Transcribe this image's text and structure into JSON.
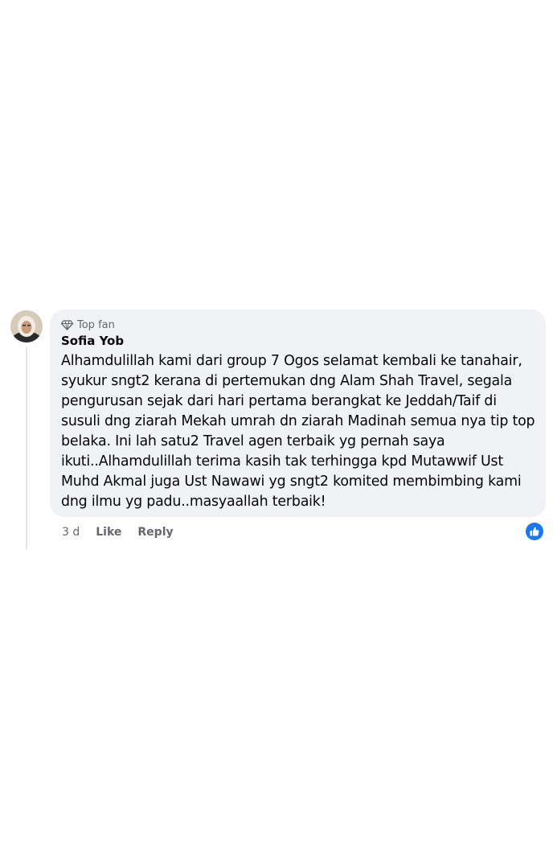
{
  "comment": {
    "badge_label": "Top fan",
    "author": "Sofia Yob",
    "text": "Alhamdulillah kami dari group 7 Ogos selamat kembali ke tanahair, syukur sngt2 kerana di pertemukan dng Alam Shah Travel, segala pengurusan sejak dari hari pertama berangkat ke Jeddah/Taif di susuli dng ziarah Mekah umrah dn ziarah Madinah semua nya tip top belaka. Ini lah satu2 Travel agen terbaik yg pernah saya ikuti..Alhamdulillah terima kasih tak terhingga kpd Mutawwif Ust Muhd Akmal juga Ust Nawawi yg sngt2 komited membimbing kami dng ilmu yg padu..masyaallah terbaik!",
    "lines": [
      "Alhamdulillah kami dari group 7 Ogos selamat kembali ke tanahair,",
      "syukur sngt2 kerana di pertemukan dng Alam Shah Travel, segala",
      "pengurusan sejak dari hari pertama berangkat ke Jeddah/Taif di",
      "susuli dng ziarah Mekah umrah dn ziarah Madinah semua nya tip top",
      "belaka. Ini lah satu2 Travel agen terbaik yg pernah saya",
      "ikuti..Alhamdulillah terima kasih tak terhingga kpd Mutawwif Ust",
      "Muhd Akmal juga Ust Nawawi yg sngt2 komited membimbing kami",
      "dng ilmu yg padu..masyaallah terbaik!"
    ],
    "time": "3 d",
    "like_label": "Like",
    "reply_label": "Reply",
    "reaction_icon": "thumbs-up-icon",
    "badge_icon": "diamond-icon"
  },
  "colors": {
    "bubble_bg": "#f0f2f5",
    "meta_text": "#65676b",
    "reaction_blue": "#1877f2"
  }
}
